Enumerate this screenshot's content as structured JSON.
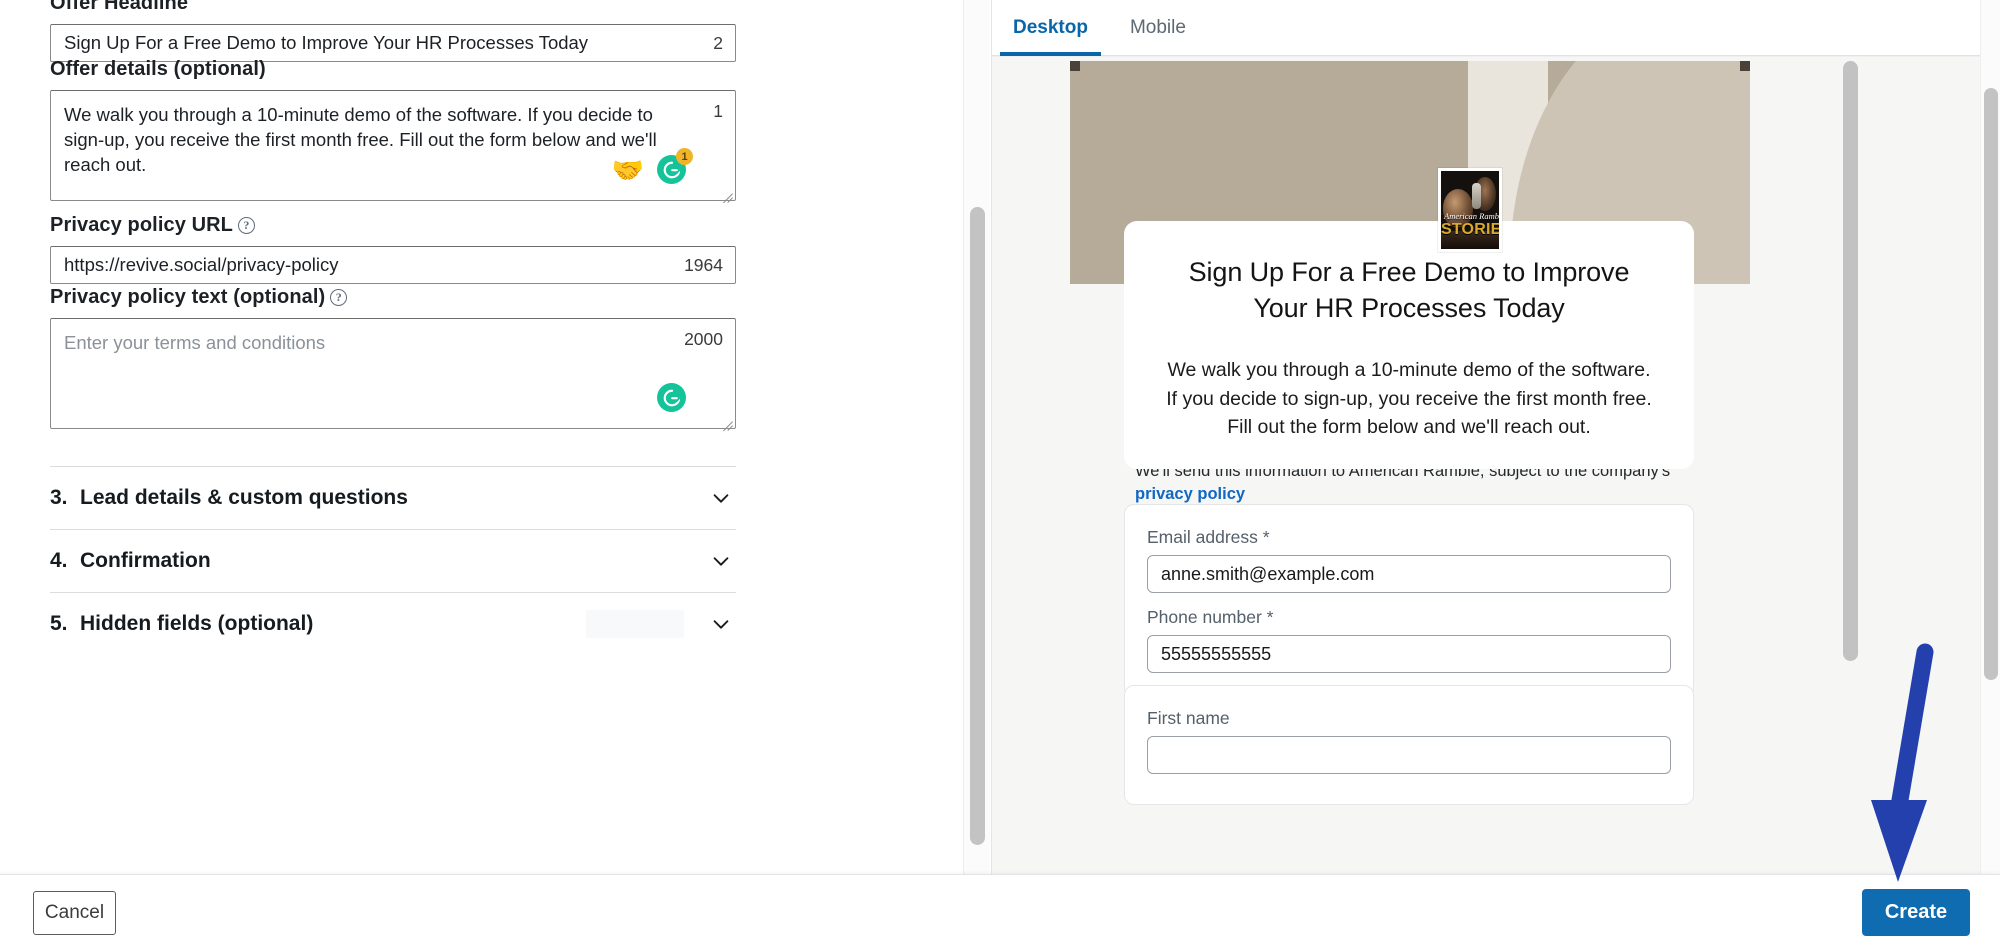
{
  "form": {
    "offer_headline": {
      "label": "Offer Headline",
      "value": "Sign Up For a Free Demo to Improve Your HR Processes Today",
      "counter": "2"
    },
    "offer_details": {
      "label": "Offer details (optional)",
      "value": "We walk you through a 10-minute demo of the software. If you decide to sign-up, you receive the first month free. Fill out the form below and we'll reach out.",
      "counter": "1",
      "emoji_icon": "handshake-emoji",
      "grammarly_badge": "1"
    },
    "privacy_policy_url": {
      "label": "Privacy policy URL",
      "value": "https://revive.social/privacy-policy",
      "counter": "1964",
      "help_icon": "question-mark-icon"
    },
    "privacy_policy_text": {
      "label": "Privacy policy text (optional)",
      "placeholder": "Enter your terms and conditions",
      "value": "",
      "counter": "2000",
      "help_icon": "question-mark-icon"
    },
    "sections": [
      {
        "number": "3.",
        "title": "Lead details & custom questions",
        "expanded": false,
        "chevron": "chevron-down-icon"
      },
      {
        "number": "4.",
        "title": "Confirmation",
        "expanded": false,
        "chevron": "chevron-down-icon"
      },
      {
        "number": "5.",
        "title": "Hidden fields (optional)",
        "expanded": false,
        "chevron": "chevron-down-icon",
        "has_placeholder_badge": true
      }
    ]
  },
  "preview": {
    "tabs": [
      {
        "label": "Desktop",
        "active": true
      },
      {
        "label": "Mobile",
        "active": false
      }
    ],
    "logo": {
      "name": "american-ramble-stories-logo",
      "script_text": "American Ramble",
      "title_text": "STORIES"
    },
    "card": {
      "title": "Sign Up For a Free Demo to Improve Your HR Processes Today",
      "body": "We walk you through a 10-minute demo of the software. If you decide to sign-up, you receive the first month free. Fill out the form below and we'll reach out."
    },
    "legal": {
      "text": "We'll send this information to American Ramble, subject to the company's ",
      "link_text": "privacy policy"
    },
    "fields": [
      {
        "label": "Email address *",
        "value": "anne.smith@example.com"
      },
      {
        "label": "Phone number *",
        "value": "55555555555"
      },
      {
        "label": "First name",
        "value": ""
      }
    ]
  },
  "footer": {
    "cancel_label": "Cancel",
    "create_label": "Create"
  },
  "annotation": {
    "arrow": "down-arrow-annotation",
    "color": "#2440ad"
  },
  "colors": {
    "accent_blue": "#0a66a8",
    "create_button": "#0f6cb0",
    "link_blue": "#1167c4",
    "grammarly_green": "#15c39a",
    "badge_yellow": "#f0b429",
    "cover_taupe": "#b6ab99",
    "annotation_blue": "#2440ad"
  }
}
